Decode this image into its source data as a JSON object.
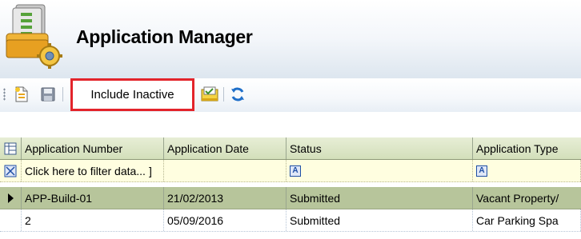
{
  "header": {
    "title": "Application Manager",
    "icon": "application-manager-icon"
  },
  "toolbar": {
    "new_icon": "new-document-icon",
    "save_icon": "save-icon",
    "include_inactive_label": "Include Inactive",
    "report_icon": "report-icon",
    "refresh_icon": "refresh-icon"
  },
  "grid": {
    "columns": [
      "Application Number",
      "Application Date",
      "Status",
      "Application Type"
    ],
    "filter_placeholder": "Click here to filter data...",
    "filter_glyph": "A",
    "rows": [
      {
        "number": "APP-Build-01",
        "date": "21/02/2013",
        "status": "Submitted",
        "type": "Vacant Property/"
      },
      {
        "number": "2",
        "date": "05/09/2016",
        "status": "Submitted",
        "type": "Car Parking Spa"
      }
    ]
  },
  "colors": {
    "highlight_border": "#e3242b",
    "selected_row": "#b7c59b",
    "header_row": "#d3dfba",
    "filter_row": "#fffee0"
  }
}
